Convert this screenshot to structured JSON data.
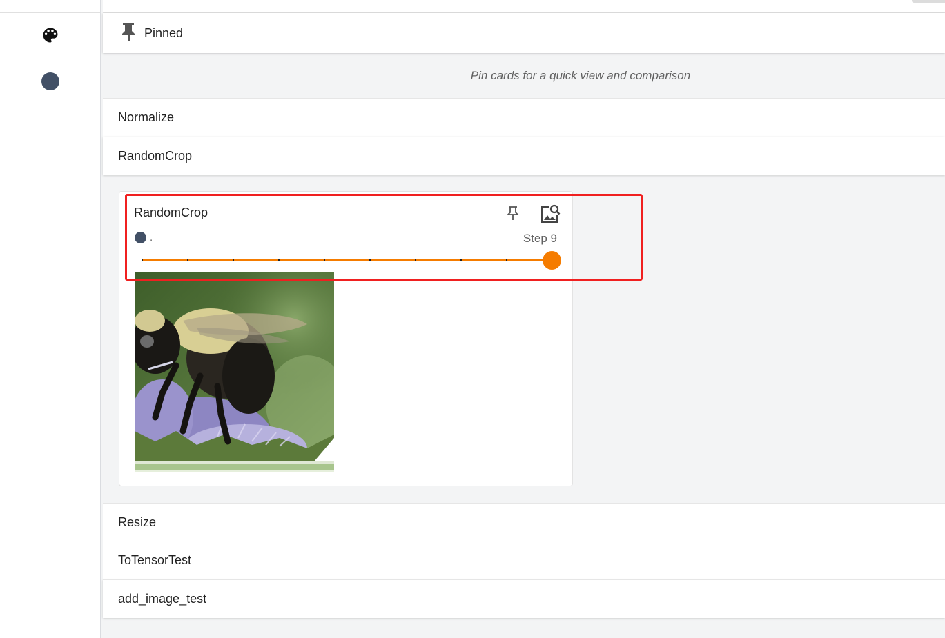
{
  "left_rail": {
    "icon_name": "palette-icon",
    "run_color": "#425066"
  },
  "pinned": {
    "label": "Pinned",
    "icon_name": "pin-icon",
    "empty_message": "Pin cards for a quick view and comparison"
  },
  "groups": [
    {
      "label": "Normalize"
    },
    {
      "label": "RandomCrop"
    },
    {
      "label": "Resize"
    },
    {
      "label": "ToTensorTest"
    },
    {
      "label": "add_image_test"
    }
  ],
  "card": {
    "title": "RandomCrop",
    "pin_icon": "pin-icon",
    "view_icon": "image-search-icon",
    "run_name": ".",
    "run_color": "#425066",
    "step_label": "Step 9",
    "slider": {
      "min": 0,
      "max": 9,
      "value": 9,
      "ticks": 10
    },
    "slider_color": "#f57c00",
    "image_subject": "bumblebee on purple flower"
  },
  "colors": {
    "accent": "#f57c00",
    "highlight": "#f02020"
  }
}
